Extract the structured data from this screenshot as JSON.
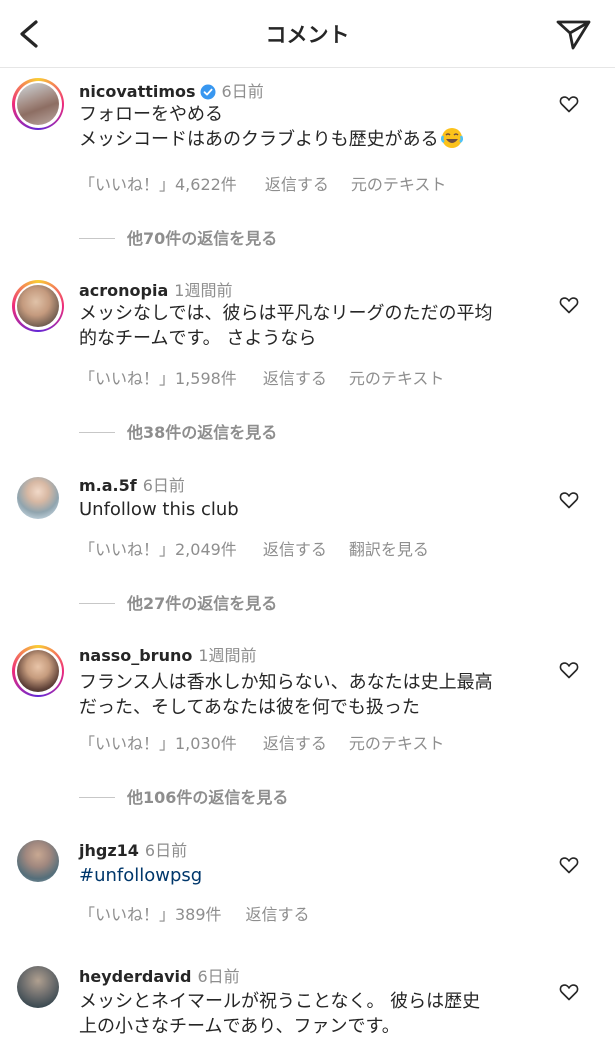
{
  "header": {
    "title": "コメント",
    "back_icon": "chevron-left-icon",
    "send_icon": "paper-plane-icon"
  },
  "comments": [
    {
      "username": "nicovattimos",
      "verified": true,
      "time": "6日前",
      "lines": [
        "フォローをやめる",
        "メッシコードはあのクラブよりも歴史がある"
      ],
      "emoji": "😂",
      "likes": "「いいね！」4,622件",
      "reply": "返信する",
      "extra_action": "元のテキスト",
      "view_replies": "他70件の返信を見る"
    },
    {
      "username": "acronopia",
      "time": "1週間前",
      "lines": [
        "メッシなしでは、彼らは平凡なリーグのただの平均",
        "的なチームです。 さようなら"
      ],
      "likes": "「いいね！」1,598件",
      "reply": "返信する",
      "extra_action": "元のテキスト",
      "view_replies": "他38件の返信を見る"
    },
    {
      "username": "m.a.5f",
      "time": "6日前",
      "lines": [
        "Unfollow this club"
      ],
      "likes": "「いいね！」2,049件",
      "reply": "返信する",
      "extra_action": "翻訳を見る",
      "view_replies": "他27件の返信を見る"
    },
    {
      "username": "nasso_bruno",
      "time": "1週間前",
      "lines": [
        "フランス人は香水しか知らない、あなたは史上最高",
        "だった、そしてあなたは彼を何でも扱った"
      ],
      "likes": "「いいね！」1,030件",
      "reply": "返信する",
      "extra_action": "元のテキスト",
      "view_replies": "他106件の返信を見る"
    },
    {
      "username": "jhgz14",
      "time": "6日前",
      "lines": [
        "#unfollowpsg"
      ],
      "likes": "「いいね！」389件",
      "reply": "返信する"
    },
    {
      "username": "heyderdavid",
      "time": "6日前",
      "lines": [
        "メッシとネイマールが祝うことなく。 彼らは歴史",
        "上の小さなチームであり、ファンです。"
      ]
    }
  ],
  "colors": {
    "text": "#262626",
    "secondary": "#8e8e8e",
    "hashtag": "#00376b",
    "verified": "#3897f0"
  }
}
